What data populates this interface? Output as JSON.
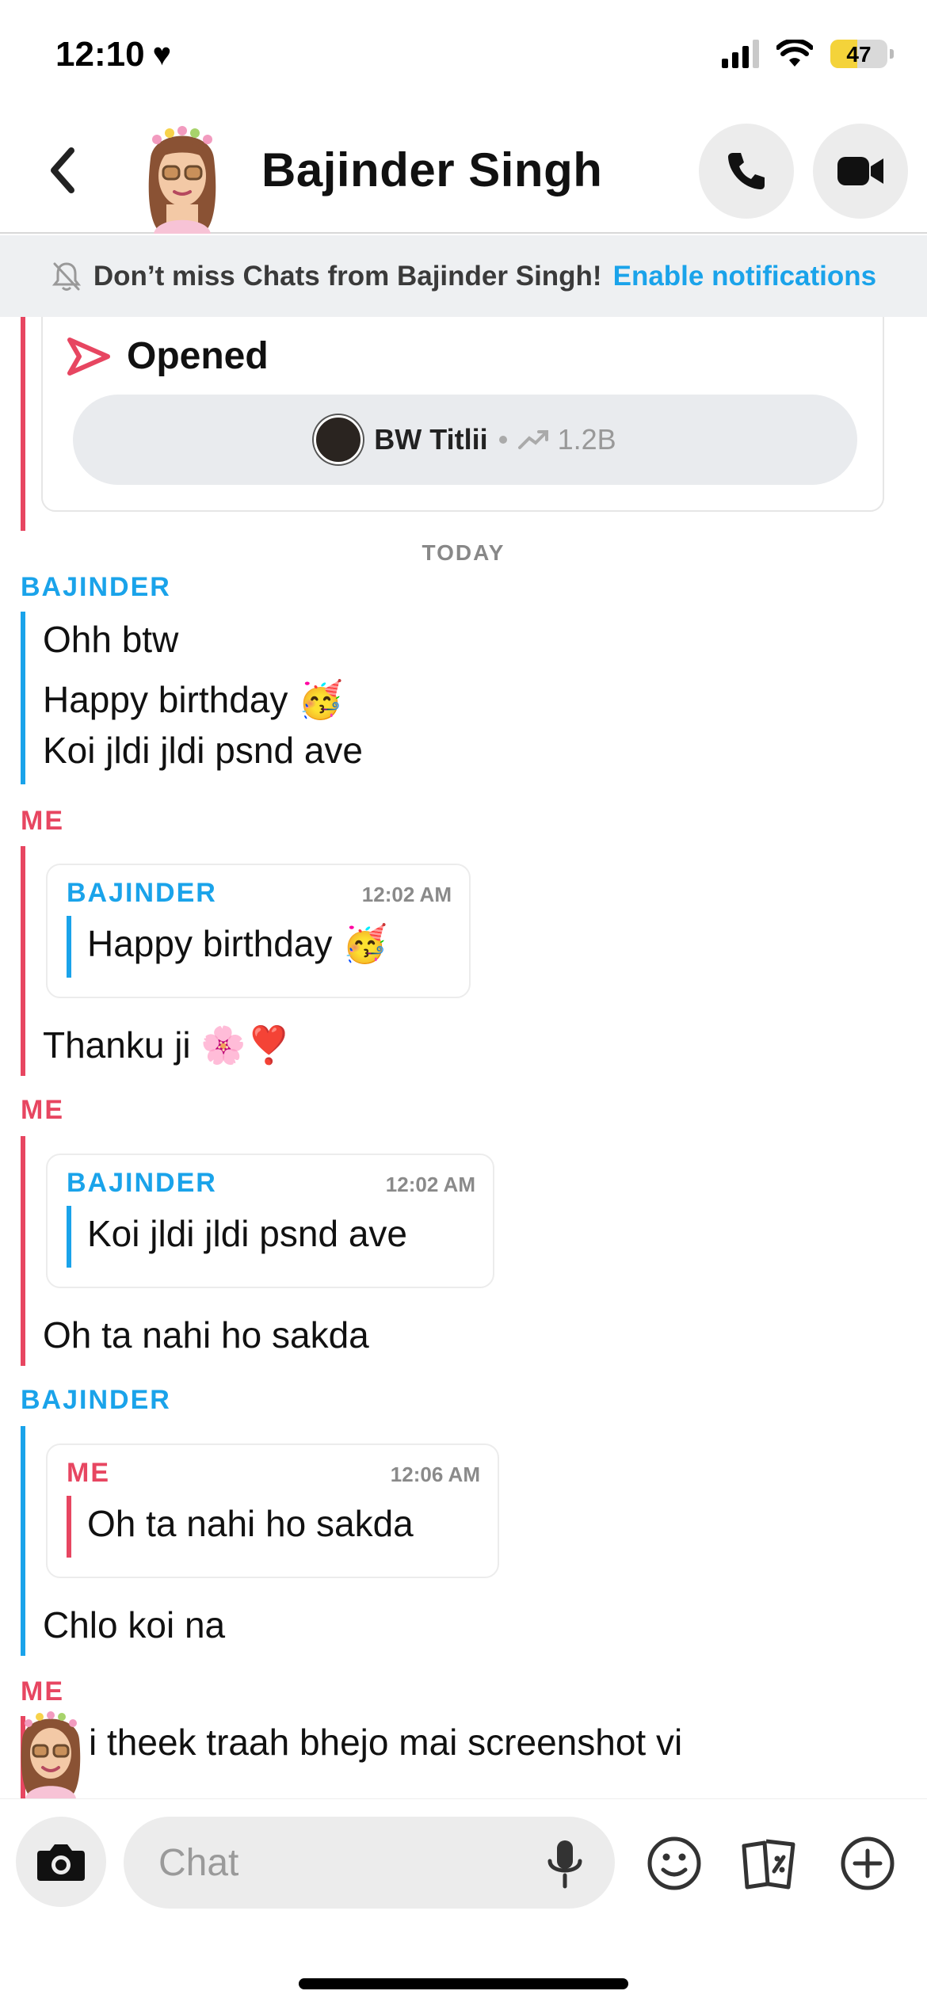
{
  "status_bar": {
    "time": "12:10",
    "battery": "47",
    "battery_level": 0.47,
    "battery_color": "#f4d33a"
  },
  "header": {
    "contact_name": "Bajinder Singh"
  },
  "notification": {
    "message": "Don’t miss Chats from Bajinder Singh!",
    "link": "Enable notifications"
  },
  "story": {
    "status": "Opened",
    "publisher": "BW Titlii",
    "views": "1.2B"
  },
  "divider": {
    "label": "TODAY"
  },
  "messages": [
    {
      "sender": "BAJINDER",
      "lines": [
        "Ohh btw",
        "Happy birthday 🥳",
        "Koi jldi jldi psnd ave"
      ]
    },
    {
      "sender": "ME",
      "quote": {
        "sender": "BAJINDER",
        "time": "12:02 AM",
        "text": "Happy birthday 🥳"
      },
      "text": "Thanku ji 🌸❣️"
    },
    {
      "sender": "ME",
      "quote": {
        "sender": "BAJINDER",
        "time": "12:02 AM",
        "text": "Koi jldi jldi psnd ave"
      },
      "text": "Oh ta nahi ho sakda"
    },
    {
      "sender": "BAJINDER",
      "quote": {
        "sender": "ME",
        "time": "12:06 AM",
        "text": "Oh ta nahi ho sakda"
      },
      "text": "Chlo koi na"
    },
    {
      "sender": "ME",
      "text": "i theek traah bhejo mai screenshot vi"
    }
  ],
  "composer": {
    "placeholder": "Chat"
  },
  "colors": {
    "blue": "#1aa3ea",
    "red": "#e74661",
    "pill": "#e9ebee"
  }
}
